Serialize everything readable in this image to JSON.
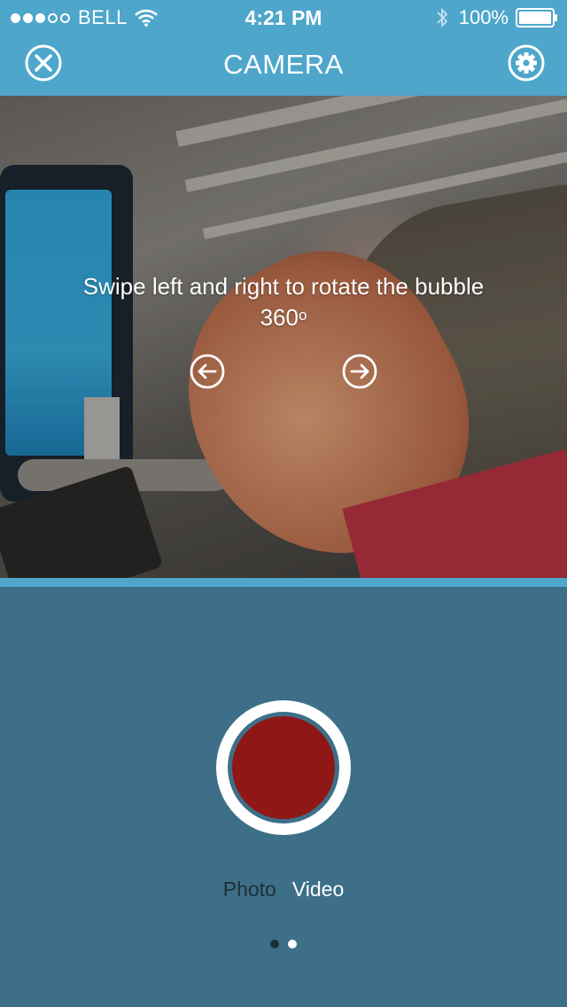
{
  "status_bar": {
    "signal_dots": [
      true,
      true,
      true,
      false,
      false
    ],
    "carrier": "BELL",
    "time": "4:21 PM",
    "battery": "100%",
    "icons": [
      "wifi-icon",
      "bluetooth-icon",
      "battery-icon"
    ]
  },
  "nav": {
    "title": "CAMERA",
    "left_icon": "close-icon",
    "right_icon": "gear-icon"
  },
  "preview": {
    "hint_text": "Swipe left and right to rotate the bubble 360",
    "hint_superscript": "o",
    "left_arrow_icon": "arrow-left-circle-icon",
    "right_arrow_icon": "arrow-right-circle-icon"
  },
  "controls": {
    "shutter_icon": "record-button",
    "modes": [
      {
        "label": "Photo",
        "active": false
      },
      {
        "label": "Video",
        "active": true
      }
    ],
    "pager": {
      "count": 2,
      "current": 2
    }
  },
  "colors": {
    "top_bar": "#4ea6cb",
    "background": "#3d7088",
    "record": "#8f1716",
    "inactive_text": "#1e2e38"
  }
}
